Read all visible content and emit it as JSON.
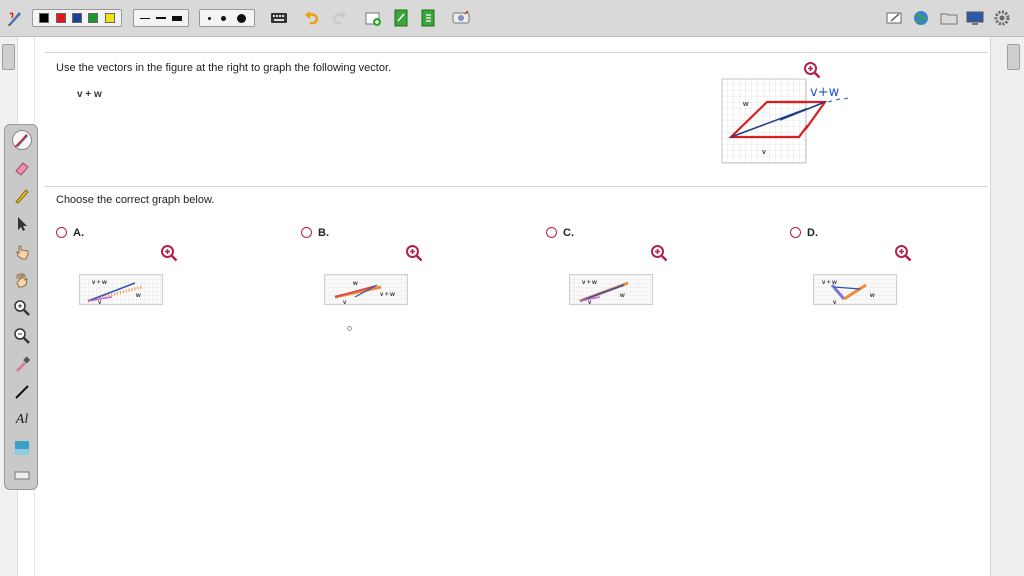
{
  "toolbar": {
    "colors": [
      "#000000",
      "#e5121b",
      "#1a3f9a",
      "#1a9a2a",
      "#f2e21a"
    ],
    "line_styles": [
      "thin",
      "medium",
      "thick"
    ],
    "dot_sizes": [
      "small",
      "medium",
      "large"
    ],
    "icons": [
      "pen-settings-icon",
      "keyboard-icon",
      "undo-icon",
      "redo-icon",
      "add-page-icon",
      "new-page-icon",
      "export-icon",
      "screen-capture-icon",
      "clear-icon",
      "globe-icon",
      "folder-icon",
      "display-icon",
      "settings-icon"
    ]
  },
  "palette": {
    "tools": [
      "pen",
      "eraser",
      "highlighter",
      "pointer",
      "hand-pointer",
      "hand-move",
      "zoom-in",
      "zoom-out",
      "eyedropper",
      "line",
      "text",
      "image",
      "keyboard"
    ]
  },
  "question": {
    "prompt": "Use the vectors in the figure at the right to graph the following vector.",
    "expression": "v + w",
    "choose": "Choose the correct graph below."
  },
  "figure": {
    "labels": {
      "w": "w",
      "v": "v"
    },
    "annotation": "v+w"
  },
  "options": [
    {
      "letter": "A.",
      "sum_label": "v + w",
      "w_label": "w",
      "v_label": "v"
    },
    {
      "letter": "B.",
      "sum_label": "v + w",
      "w_label": "w",
      "v_label": "v"
    },
    {
      "letter": "C.",
      "sum_label": "v + w",
      "w_label": "w",
      "v_label": "v"
    },
    {
      "letter": "D.",
      "sum_label": "v + w",
      "w_label": "w",
      "v_label": "v"
    }
  ]
}
